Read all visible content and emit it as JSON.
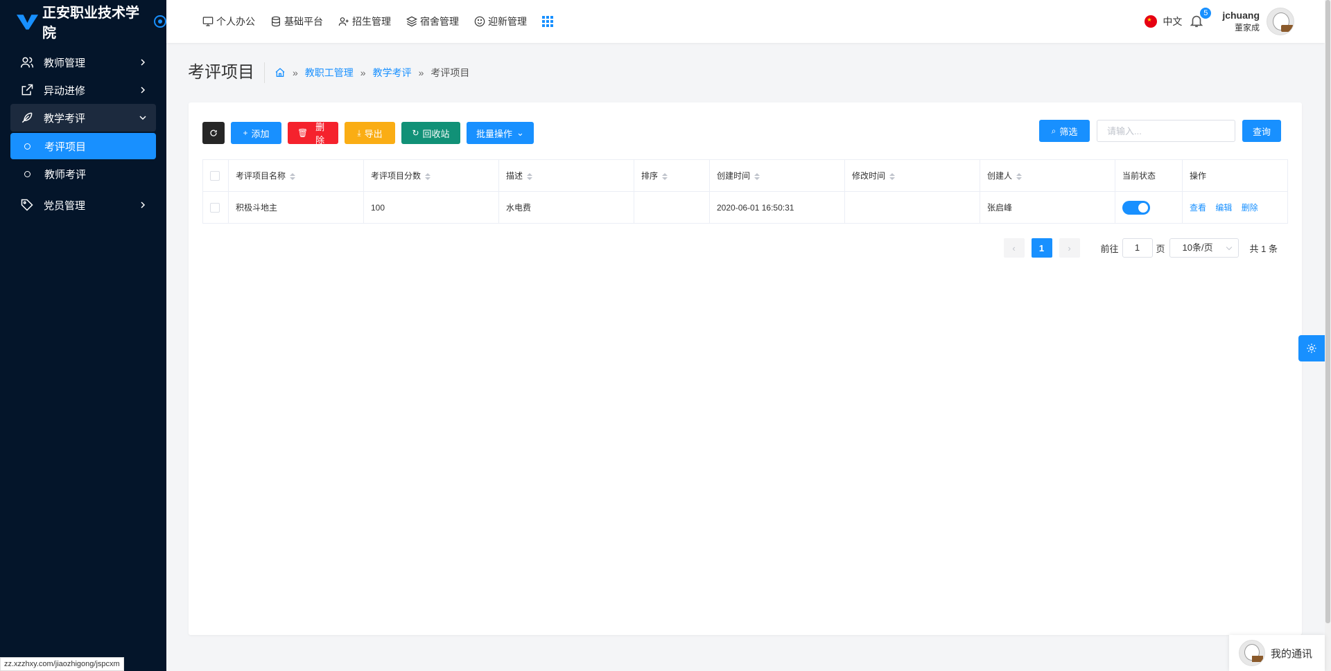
{
  "app": {
    "title": "正安职业技术学院"
  },
  "sidebar": {
    "items": [
      {
        "label": "教师管理",
        "icon": "users-icon"
      },
      {
        "label": "异动进修",
        "icon": "external-link-icon"
      },
      {
        "label": "教学考评",
        "icon": "feather-icon",
        "open": true,
        "children": [
          {
            "label": "考评项目",
            "active": true
          },
          {
            "label": "教师考评"
          }
        ]
      },
      {
        "label": "党员管理",
        "icon": "tag-icon"
      }
    ]
  },
  "topnav": [
    {
      "label": "个人办公",
      "icon": "monitor-icon"
    },
    {
      "label": "基础平台",
      "icon": "database-icon"
    },
    {
      "label": "招生管理",
      "icon": "user-plus-icon"
    },
    {
      "label": "宿舍管理",
      "icon": "layers-icon"
    },
    {
      "label": "迎新管理",
      "icon": "smile-icon"
    }
  ],
  "header": {
    "language": "中文",
    "notification_count": "5",
    "username": "jchuang",
    "display_name": "董家成"
  },
  "page": {
    "title": "考评项目",
    "breadcrumb": [
      "教职工管理",
      "教学考评",
      "考评项目"
    ]
  },
  "toolbar": {
    "add": "添加",
    "delete": "删除",
    "export": "导出",
    "recycle": "回收站",
    "batch": "批量操作",
    "filter": "筛选",
    "search_placeholder": "请输入...",
    "query": "查询"
  },
  "table": {
    "columns": [
      "考评项目名称",
      "考评项目分数",
      "描述",
      "排序",
      "创建时间",
      "修改时间",
      "创建人",
      "当前状态",
      "操作"
    ],
    "rows": [
      {
        "name": "积极斗地主",
        "score": "100",
        "desc": "水电费",
        "order": "",
        "created": "2020-06-01 16:50:31",
        "modified": "",
        "creator": "张启峰",
        "status": true,
        "actions": [
          "查看",
          "编辑",
          "删除"
        ]
      }
    ]
  },
  "pagination": {
    "current": "1",
    "goto_label": "前往",
    "goto_value": "1",
    "page_unit": "页",
    "page_size": "10条/页",
    "total": "共 1 条"
  },
  "chat": {
    "label": "我的通讯"
  },
  "status_url": "zz.xzzhxy.com/jiaozhigong/jspcxm",
  "colors": {
    "sidebar": "#04152a",
    "primary": "#1890ff",
    "danger": "#f5222d",
    "warning": "#faad14",
    "teal": "#119177"
  }
}
